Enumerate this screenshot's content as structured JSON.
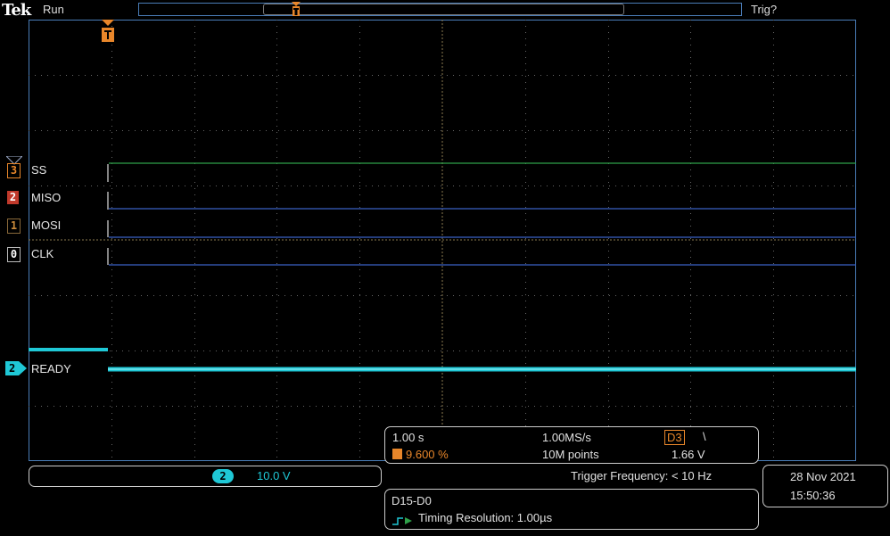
{
  "top_bar": {
    "brand": "Tek",
    "acq_state": "Run",
    "trigger_status": "Trig?"
  },
  "trigger_marker": "T",
  "channels": [
    {
      "num": "3",
      "name": "SS",
      "color": "#e8862a",
      "trace_color": "#2fa14a"
    },
    {
      "num": "2",
      "name": "MISO",
      "color": "#d0452e",
      "trace_color": "#3a5fc4"
    },
    {
      "num": "1",
      "name": "MOSI",
      "color": "#8a6a3a",
      "trace_color": "#3a5fc4"
    },
    {
      "num": "0",
      "name": "CLK",
      "color": "#9a9a9a",
      "trace_color": "#3a5fc4"
    }
  ],
  "analog_channel": {
    "num": "2",
    "name": "READY",
    "color": "#1fc8d6"
  },
  "acquisition": {
    "timebase": "1.00 s",
    "sample_rate": "1.00MS/s",
    "trigger_source": "D3",
    "trigger_slope": "\\",
    "trigger_position": "9.600 %",
    "record_length": "10M points",
    "trigger_level": "1.66 V"
  },
  "channel_scale": {
    "num": "2",
    "value": "10.0 V"
  },
  "trigger_frequency": "Trigger Frequency: < 10 Hz",
  "datetime": {
    "date": "28 Nov 2021",
    "time": "15:50:36"
  },
  "bus": {
    "name": "D15-D0",
    "resolution": "Timing Resolution: 1.00µs"
  },
  "colors": {
    "orange": "#e8862a",
    "cyan": "#1fc8d6",
    "grid": "#7a7a7a",
    "frame": "#4a7db8"
  }
}
